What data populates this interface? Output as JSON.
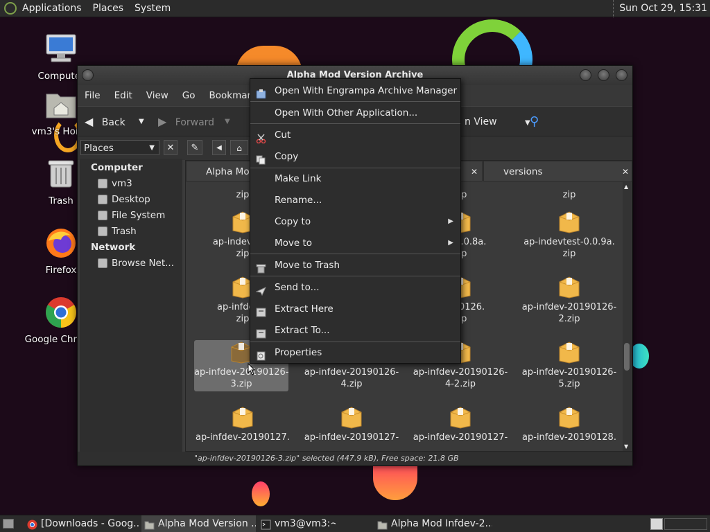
{
  "panel": {
    "menus": [
      "Applications",
      "Places",
      "System"
    ],
    "clock": "Sun Oct 29, 15:31"
  },
  "desktop": {
    "icons": [
      {
        "label": "Computer",
        "icon": "computer-icon"
      },
      {
        "label": "vm3's Home",
        "icon": "home-folder-icon"
      },
      {
        "label": "Trash",
        "icon": "trash-icon"
      },
      {
        "label": "Firefox",
        "icon": "firefox-icon"
      },
      {
        "label": "Google Chrome",
        "icon": "chrome-icon"
      }
    ]
  },
  "window": {
    "title": "Alpha Mod Version Archive",
    "menubar": [
      "File",
      "Edit",
      "View",
      "Go",
      "Bookmarks"
    ],
    "toolbar": {
      "back": "Back",
      "forward": "Forward",
      "view": "n View"
    },
    "sidebar_dropdown": "Places",
    "sidebar": {
      "computer_heading": "Computer",
      "computer_items": [
        "vm3",
        "Desktop",
        "File System",
        "Trash"
      ],
      "network_heading": "Network",
      "network_items": [
        "Browse Net..."
      ]
    },
    "tabs": [
      "Alpha Mod",
      "versions"
    ],
    "files": [
      {
        "name": "zip",
        "row": 0,
        "col": 0
      },
      {
        "name": "zip",
        "row": 0,
        "col": 2
      },
      {
        "name": "zip",
        "row": 0,
        "col": 3
      },
      {
        "name": "ap-indevtest-\nzip",
        "row": 1,
        "col": 0
      },
      {
        "name": "test-0.0.8a.\nzip",
        "row": 1,
        "col": 2
      },
      {
        "name": "ap-indevtest-0.0.9a.\nzip",
        "row": 1,
        "col": 3
      },
      {
        "name": "ap-infdev-2\nzip",
        "row": 2,
        "col": 0
      },
      {
        "name": "20190126.\nzip",
        "row": 2,
        "col": 2
      },
      {
        "name": "ap-infdev-20190126-\n2.zip",
        "row": 2,
        "col": 3
      },
      {
        "name": "ap-infdev-20190126-\n3.zip",
        "row": 3,
        "col": 0,
        "selected": true
      },
      {
        "name": "ap-infdev-20190126-\n4.zip",
        "row": 3,
        "col": 1
      },
      {
        "name": "ap-infdev-20190126-\n4-2.zip",
        "row": 3,
        "col": 2
      },
      {
        "name": "ap-infdev-20190126-\n5.zip",
        "row": 3,
        "col": 3
      },
      {
        "name": "ap-infdev-20190127.",
        "row": 4,
        "col": 0
      },
      {
        "name": "ap-infdev-20190127-",
        "row": 4,
        "col": 1
      },
      {
        "name": "ap-infdev-20190127-",
        "row": 4,
        "col": 2
      },
      {
        "name": "ap-infdev-20190128.",
        "row": 4,
        "col": 3
      }
    ],
    "status": "\"ap-infdev-20190126-3.zip\" selected (447.9 kB), Free space: 21.8 GB"
  },
  "context_menu": {
    "items": [
      {
        "label": "Open With Engrampa Archive Manager",
        "icon": "archive-manager-icon"
      },
      {
        "label": "Open With Other Application...",
        "icon": ""
      },
      {
        "label": "Cut",
        "icon": "scissors-icon"
      },
      {
        "label": "Copy",
        "icon": "copy-icon"
      },
      {
        "label": "Make Link",
        "icon": ""
      },
      {
        "label": "Rename...",
        "icon": ""
      },
      {
        "label": "Copy to",
        "icon": "",
        "submenu": true
      },
      {
        "label": "Move to",
        "icon": "",
        "submenu": true
      },
      {
        "label": "Move to Trash",
        "icon": "trash-icon"
      },
      {
        "label": "Send to...",
        "icon": "send-icon"
      },
      {
        "label": "Extract Here",
        "icon": "extract-icon"
      },
      {
        "label": "Extract To...",
        "icon": "extract-icon"
      },
      {
        "label": "Properties",
        "icon": "properties-icon"
      }
    ]
  },
  "taskbar": {
    "tasks": [
      {
        "label": "[Downloads - Goog...",
        "icon": "chrome-icon"
      },
      {
        "label": "Alpha Mod Version ...",
        "icon": "folder-icon",
        "active": true
      },
      {
        "label": "vm3@vm3:~",
        "icon": "terminal-icon"
      },
      {
        "label": "Alpha Mod Infdev-2...",
        "icon": "folder-icon"
      }
    ]
  },
  "colors": {
    "accent_orange": "#f59a1f",
    "desktop_bg": "#1c0a19",
    "selection": "#6d6d6d"
  }
}
